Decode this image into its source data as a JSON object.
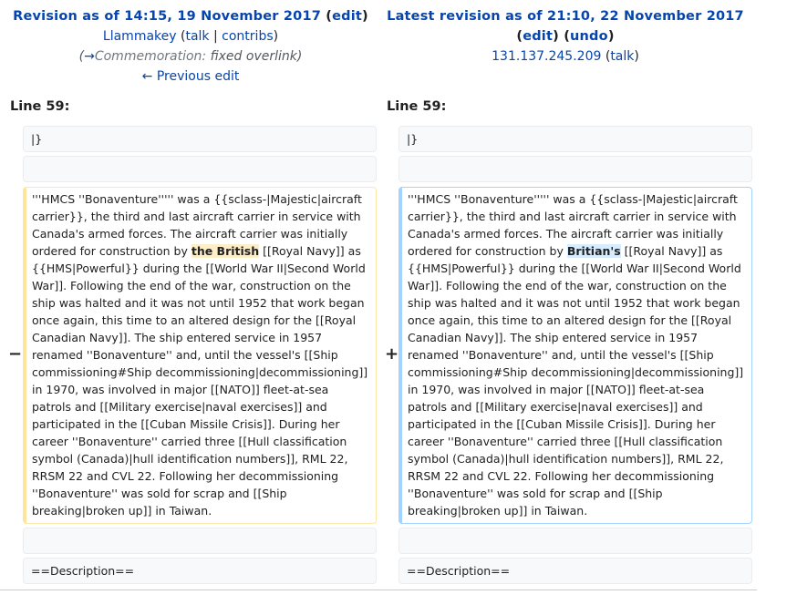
{
  "left": {
    "title_prefix": "Revision as of 14:15, 19 November 2017",
    "edit_label": "edit",
    "user": "Llammakey",
    "talk": "talk",
    "contribs": "contribs",
    "summary_arrow": "→",
    "summary_section": "Commemoration:",
    "summary_text": " fixed overlink",
    "previous_edit": "← Previous edit",
    "line_label": "Line 59:",
    "ctx1": "|}",
    "ctx_desc": "==Description==",
    "text_before": "'''HMCS ''Bonaventure''''' was a {{sclass-|Majestic|aircraft carrier}}, the third and last aircraft carrier in service with Canada's armed forces. The aircraft carrier was initially ordered for construction by ",
    "text_highlight": "the British",
    "text_after": " [[Royal Navy]] as {{HMS|Powerful}} during the [[World War II|Second World War]]. Following the end of the war, construction on the ship was halted and it was not until 1952 that work began once again, this time to an altered design for the [[Royal Canadian Navy]]. The ship entered service in 1957 renamed ''Bonaventure'' and, until the vessel's [[Ship commissioning#Ship decommissioning|decommissioning]] in 1970, was involved in major [[NATO]] fleet-at-sea patrols and [[Military exercise|naval exercises]] and participated in the [[Cuban Missile Crisis]]. During her career ''Bonaventure'' carried three [[Hull classification symbol (Canada)|hull identification numbers]], RML 22, RRSM 22 and CVL 22. Following her decommissioning ''Bonaventure'' was sold for scrap and [[Ship breaking|broken up]] in Taiwan.",
    "marker": "−"
  },
  "right": {
    "title": "Latest revision as of 21:10, 22 November 2017",
    "edit_label": "edit",
    "undo_label": "undo",
    "user": "131.137.245.209",
    "talk": "talk",
    "line_label": "Line 59:",
    "ctx1": "|}",
    "ctx_desc": "==Description==",
    "text_before": "'''HMCS ''Bonaventure''''' was a {{sclass-|Majestic|aircraft carrier}}, the third and last aircraft carrier in service with Canada's armed forces. The aircraft carrier was initially ordered for construction by ",
    "text_highlight": "Britian's",
    "text_after": " [[Royal Navy]] as {{HMS|Powerful}} during the [[World War II|Second World War]]. Following the end of the war, construction on the ship was halted and it was not until 1952 that work began once again, this time to an altered design for the [[Royal Canadian Navy]]. The ship entered service in 1957 renamed ''Bonaventure'' and, until the vessel's [[Ship commissioning#Ship decommissioning|decommissioning]] in 1970, was involved in major [[NATO]] fleet-at-sea patrols and [[Military exercise|naval exercises]] and participated in the [[Cuban Missile Crisis]]. During her career ''Bonaventure'' carried three [[Hull classification symbol (Canada)|hull identification numbers]], RML 22, RRSM 22 and CVL 22. Following her decommissioning ''Bonaventure'' was sold for scrap and [[Ship breaking|broken up]] in Taiwan.",
    "marker": "+"
  },
  "punct": {
    "open_paren": "(",
    "close_paren": ")",
    "pipe": " | ",
    "space": " "
  }
}
